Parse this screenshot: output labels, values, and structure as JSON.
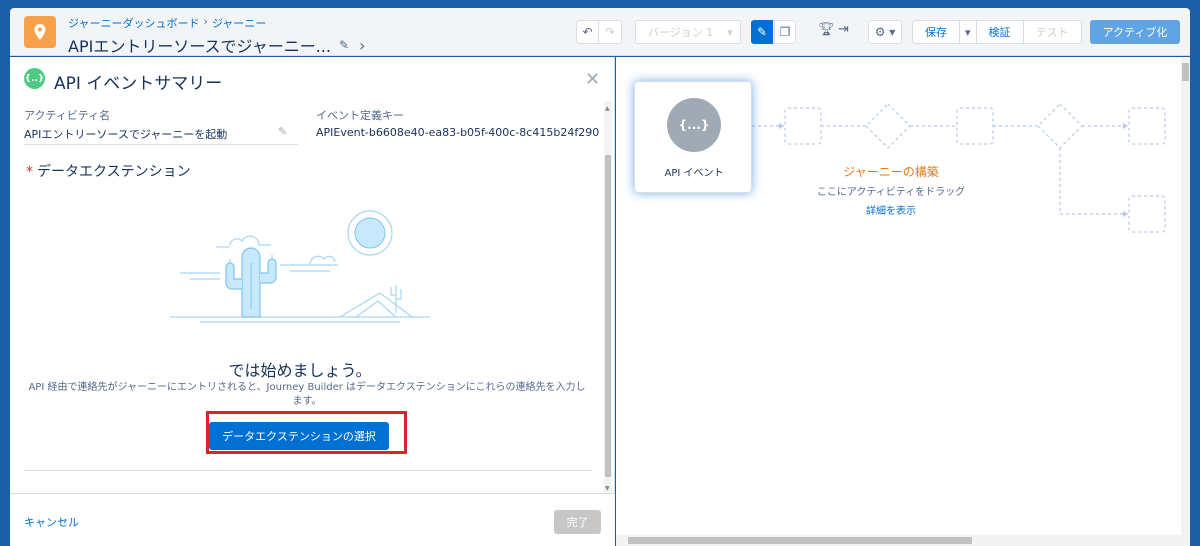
{
  "header": {
    "breadcrumb": [
      "ジャーニーダッシュボード",
      "ジャーニー"
    ],
    "breadcrumb_sep": "›",
    "title": "APIエントリーソースでジャーニー...",
    "version_select": "バージョン 1",
    "save_label": "保存",
    "validate_label": "検証",
    "test_label": "テスト",
    "activate_label": "アクティブ化"
  },
  "panel": {
    "title": "API イベントサマリー",
    "activity_name_label": "アクティビティ名",
    "activity_name_value": "APIエントリーソースでジャーニーを起動",
    "event_key_label": "イベント定義キー",
    "event_key_value": "APIEvent-b6608e40-ea83-b05f-400c-8c415b24f290",
    "data_extension_label": "データエクステンション",
    "required_marker": "*",
    "start_heading": "では始めましょう。",
    "start_desc": "API 経由で連絡先がジャーニーにエントリされると、Journey Builder はデータエクステンションにこれらの連絡先を入力します。",
    "select_de_button": "データエクステンションの選択",
    "cancel_label": "キャンセル",
    "done_label": "完了"
  },
  "canvas": {
    "entry_label": "API イベント",
    "entry_icon_text": "{...}",
    "build_title": "ジャーニーの構築",
    "build_sub": "ここにアクティビティをドラッグ",
    "build_link": "詳細を表示"
  },
  "colors": {
    "accent": "#0070d2",
    "app_icon": "#f7a04b",
    "activate_bg": "#5fa4e3",
    "highlight": "#d9232e",
    "build_title": "#e07c1b"
  }
}
